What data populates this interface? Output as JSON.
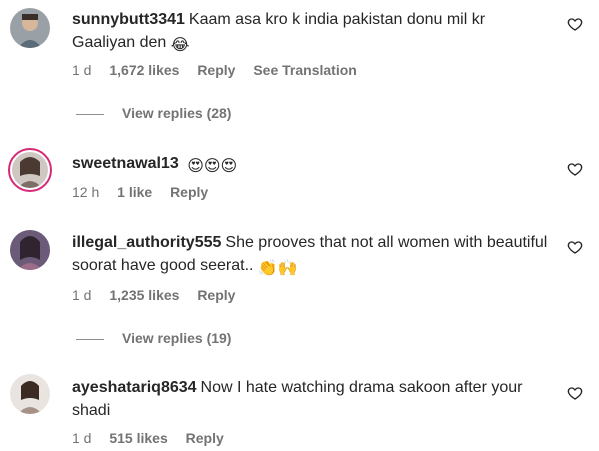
{
  "comments": [
    {
      "username": "sunnybutt3341",
      "text": "Kaam asa kro k india pakistan donu mil kr Gaaliyan den",
      "emoji": "😂",
      "time": "1 d",
      "likes": "1,672 likes",
      "reply": "Reply",
      "translate": "See Translation",
      "view_replies": "View replies (28)"
    },
    {
      "username": "sweetnawal13",
      "text": "",
      "emoji": "😍😍😍",
      "time": "12 h",
      "likes": "1 like",
      "reply": "Reply"
    },
    {
      "username": "illegal_authority555",
      "text": "She prooves that not all women with beautiful soorat have good seerat..",
      "emoji": "👏🙌",
      "time": "1 d",
      "likes": "1,235 likes",
      "reply": "Reply",
      "view_replies": "View replies (19)"
    },
    {
      "username": "ayeshatariq8634",
      "text": "Now I hate watching drama sakoon after your shadi",
      "time": "1 d",
      "likes": "515 likes",
      "reply": "Reply"
    }
  ],
  "icons": {
    "like": "heart-outline-icon"
  }
}
